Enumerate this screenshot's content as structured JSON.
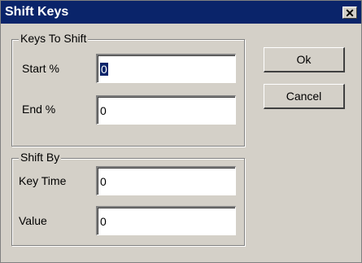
{
  "window": {
    "title": "Shift Keys",
    "close_symbol": "✕"
  },
  "keys_group": {
    "label": "Keys To Shift",
    "start_label": "Start %",
    "start_value": "0",
    "end_label": "End %",
    "end_value": "0"
  },
  "shift_group": {
    "label": "Shift By",
    "key_time_label": "Key Time",
    "key_time_value": "0",
    "value_label": "Value",
    "value_value": "0"
  },
  "buttons": {
    "ok": "Ok",
    "cancel": "Cancel"
  },
  "colors": {
    "titlebar": "#0a246a",
    "face": "#d4d0c8",
    "selection": "#0a246a"
  }
}
